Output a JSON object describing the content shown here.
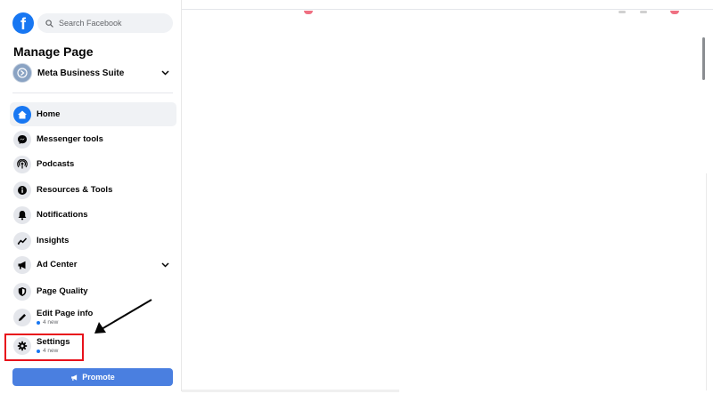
{
  "header": {
    "logo_letter": "f",
    "search_placeholder": "Search Facebook"
  },
  "page_title": "Manage Page",
  "business": {
    "label": "Meta Business Suite"
  },
  "nav": {
    "home": "Home",
    "messenger_tools": "Messenger tools",
    "podcasts": "Podcasts",
    "resources_tools": "Resources & Tools",
    "notifications": "Notifications",
    "insights": "Insights",
    "ad_center": "Ad Center",
    "page_quality": "Page Quality",
    "edit_page_info": {
      "label": "Edit Page info",
      "badge": "4 new"
    },
    "settings": {
      "label": "Settings",
      "badge": "4 new"
    }
  },
  "promote_label": "Promote",
  "colors": {
    "brand": "#1877f2",
    "highlight": "#e8111b",
    "promote": "#4a7fe0"
  }
}
